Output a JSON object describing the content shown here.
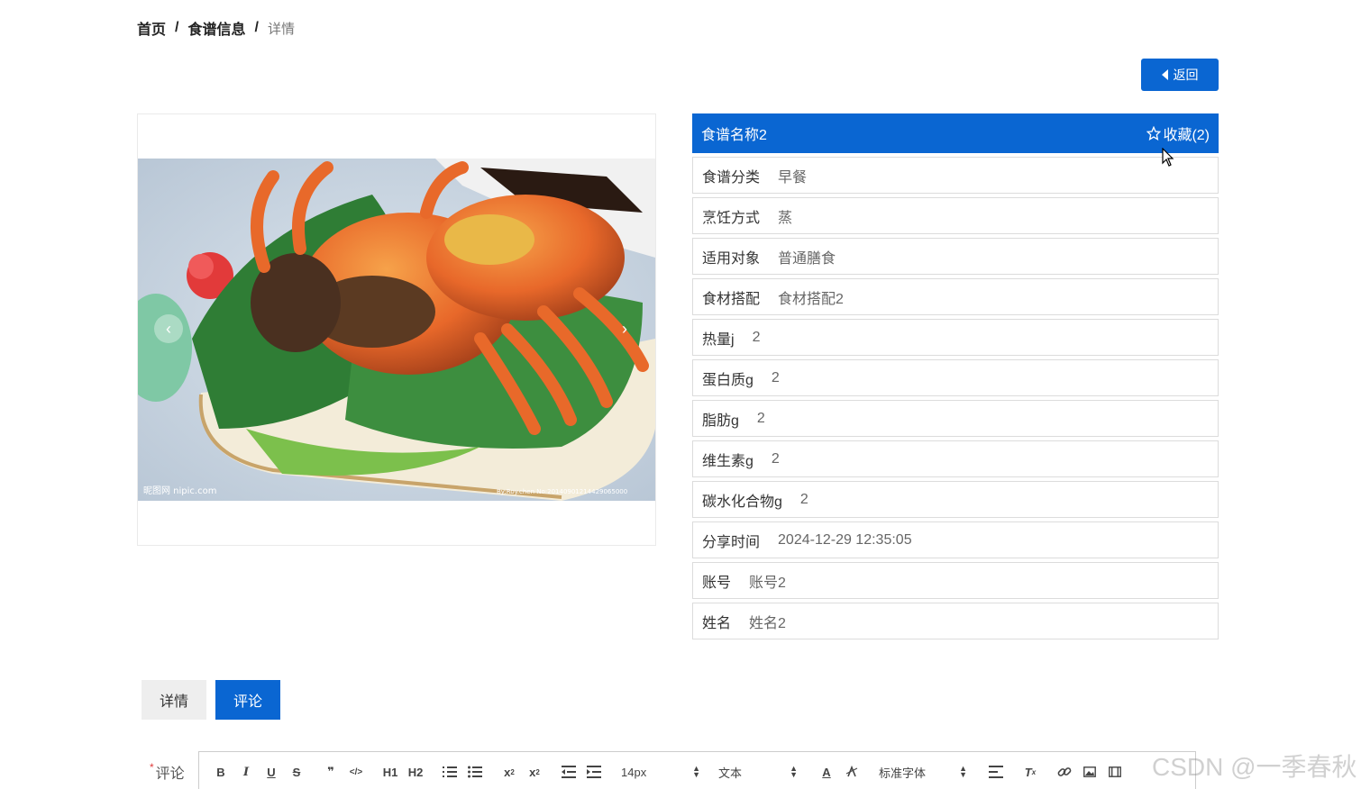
{
  "breadcrumb": {
    "home": "首页",
    "section": "食谱信息",
    "current": "详情",
    "sep": "/"
  },
  "back_button": {
    "label": "返回"
  },
  "recipe": {
    "name": "食谱名称2",
    "favorite_label": "收藏(2)",
    "fields": [
      {
        "label": "食谱分类",
        "value": "早餐"
      },
      {
        "label": "烹饪方式",
        "value": "蒸"
      },
      {
        "label": "适用对象",
        "value": "普通膳食"
      },
      {
        "label": "食材搭配",
        "value": "食材搭配2"
      },
      {
        "label": "热量j",
        "value": "2"
      },
      {
        "label": "蛋白质g",
        "value": "2"
      },
      {
        "label": "脂肪g",
        "value": "2"
      },
      {
        "label": "维生素g",
        "value": "2"
      },
      {
        "label": "碳水化合物g",
        "value": "2"
      },
      {
        "label": "分享时间",
        "value": "2024-12-29 12:35:05"
      },
      {
        "label": "账号",
        "value": "账号2"
      },
      {
        "label": "姓名",
        "value": "姓名2"
      }
    ]
  },
  "tabs": [
    {
      "label": "详情"
    },
    {
      "label": "评论"
    }
  ],
  "comment": {
    "label": "评论",
    "required_mark": "*",
    "toolbar": {
      "bold": "B",
      "italic": "I",
      "underline": "U",
      "strike": "S",
      "quote": "❞",
      "code": "</>",
      "h1": "H1",
      "h2": "H2",
      "font_size": "14px",
      "text_type": "文本",
      "font_family": "标准字体"
    }
  },
  "photo_watermarks": {
    "left": "昵图网 nipic.com",
    "right": "By:Roy.chen No:20140901214429065000"
  },
  "watermark": "CSDN @一季春秋",
  "colors": {
    "primary": "#0a66d2",
    "border": "#dcdcdc",
    "tab_inactive": "#eeeeee"
  }
}
